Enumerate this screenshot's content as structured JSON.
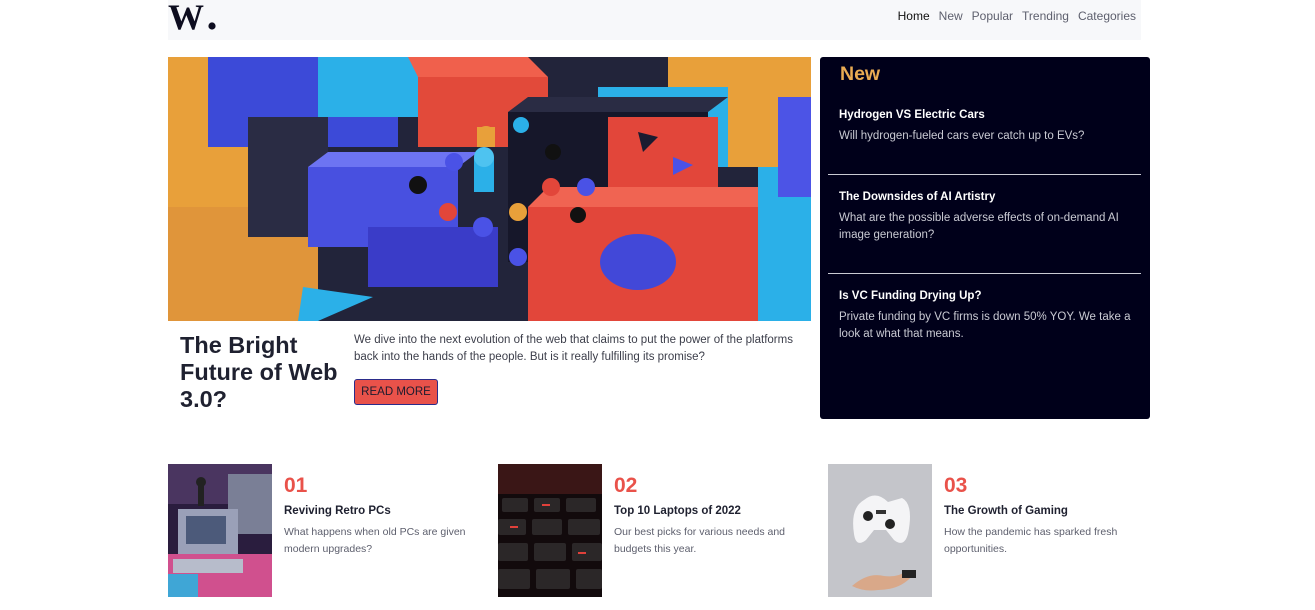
{
  "brand": {
    "logo_text": "W."
  },
  "nav": {
    "items": [
      "Home",
      "New",
      "Popular",
      "Trending",
      "Categories"
    ],
    "active": "Home"
  },
  "hero": {
    "title": "The Bright Future of Web 3.0?",
    "description": "We dive into the next evolution of the web that claims to put the power of the platforms back into the hands of the people. But is it really fulfilling its promise?",
    "button_label": "READ MORE",
    "image": "abstract-3d-blocks"
  },
  "new_section": {
    "title": "New",
    "items": [
      {
        "title": "Hydrogen VS Electric Cars",
        "description": "Will hydrogen-fueled cars ever catch up to EVs?"
      },
      {
        "title": "The Downsides of AI Artistry",
        "description": "What are the possible adverse effects of on-demand AI image generation?"
      },
      {
        "title": "Is VC Funding Drying Up?",
        "description": "Private funding by VC firms is down 50% YOY. We take a look at what that means."
      }
    ]
  },
  "articles": [
    {
      "number": "01",
      "title": "Reviving Retro PCs",
      "description": "What happens when old PCs are given modern upgrades?",
      "image": "retro-pc"
    },
    {
      "number": "02",
      "title": "Top 10 Laptops of 2022",
      "description": "Our best picks for various needs and budgets this year.",
      "image": "keyboard"
    },
    {
      "number": "03",
      "title": "The Growth of Gaming",
      "description": "How the pandemic has sparked fresh opportunities.",
      "image": "game-controller"
    }
  ],
  "colors": {
    "accent": "#e9524a",
    "panel_bg": "#00001a",
    "panel_title": "#e9ab53"
  }
}
